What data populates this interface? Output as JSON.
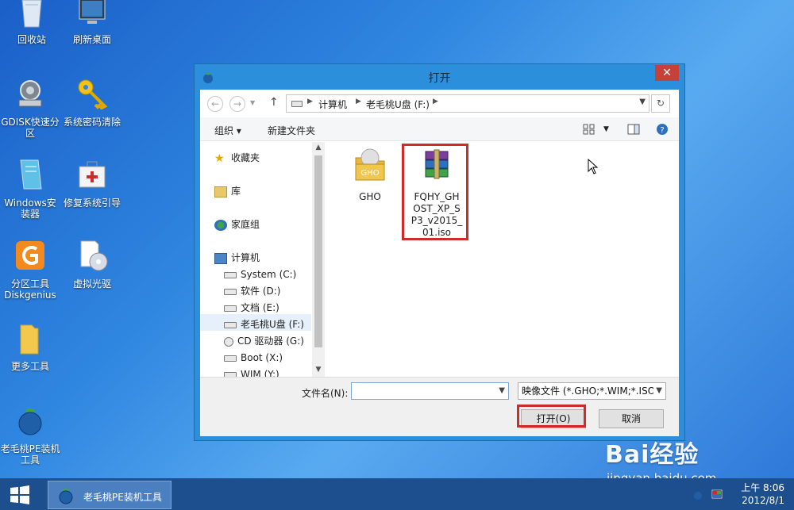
{
  "desktop": {
    "icons": [
      {
        "label": "回收站"
      },
      {
        "label": "刷新桌面"
      },
      {
        "label": "GDISK快速分\n区"
      },
      {
        "label": "系统密码清除"
      },
      {
        "label": "Windows安\n装器"
      },
      {
        "label": "修复系统引导"
      },
      {
        "label": "分区工具\nDiskgenius"
      },
      {
        "label": "虚拟光驱"
      },
      {
        "label": "更多工具"
      },
      {
        "label": "老毛桃PE装机\n工具"
      }
    ]
  },
  "dialog": {
    "title": "打开",
    "close_label": "✕",
    "address": {
      "segments": [
        "计算机",
        "老毛桃U盘 (F:)"
      ]
    },
    "toolbar": {
      "organize_label": "组织",
      "new_folder_label": "新建文件夹"
    },
    "nav": {
      "favorites": "收藏夹",
      "libraries": "库",
      "homegroup": "家庭组",
      "computer": "计算机",
      "drives": [
        "System (C:)",
        "软件 (D:)",
        "文档 (E:)",
        "老毛桃U盘 (F:)",
        "CD 驱动器 (G:)",
        "Boot (X:)",
        "WIM (Y:)"
      ]
    },
    "files": [
      {
        "name": "GHO",
        "icon": "folder-icon"
      },
      {
        "name": "FQHY_GH\nOST_XP_S\nP3_v2015_\n01.iso",
        "icon": "winrar-archive-icon"
      }
    ],
    "bottom": {
      "filename_label": "文件名(N):",
      "filename_value": "",
      "filter_value": "映像文件 (*.GHO;*.WIM;*.ISO",
      "open_label": "打开(O)",
      "cancel_label": "取消"
    }
  },
  "taskbar": {
    "task_label": "老毛桃PE装机工具",
    "time": "上午 8:06",
    "date": "2012/8/1"
  },
  "watermark": {
    "brand": "Bai经验",
    "url": "jingyan.baidu.com"
  },
  "colors": {
    "highlight": "#d02a2a",
    "dialog_frame": "#2b8fdc",
    "taskbar": "#1d4f8f"
  }
}
